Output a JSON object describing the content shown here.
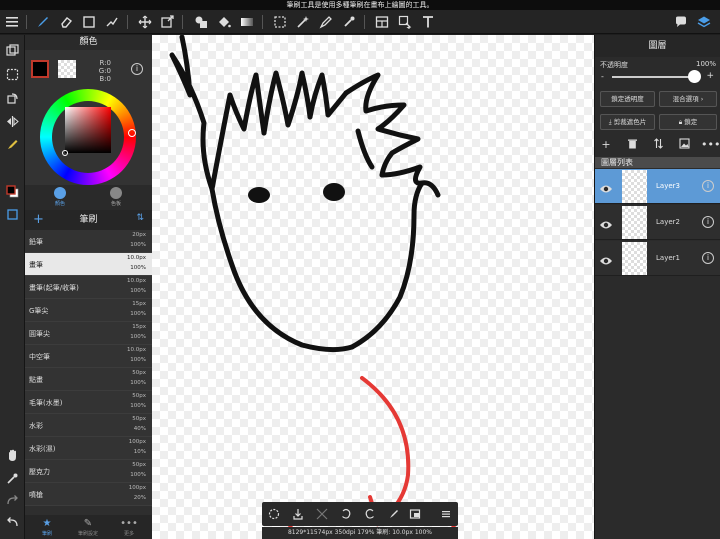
{
  "status_message": "筆刷工具是使用多種筆刷在畫布上繪圖的工具。",
  "color_panel": {
    "title": "顏色",
    "rgb": {
      "r": "R:0",
      "g": "G:0",
      "b": "B:0"
    },
    "info_label": "i",
    "tabs": [
      {
        "label": "顏色",
        "color": "#5aa0e6"
      },
      {
        "label": "色板",
        "color": "#888888"
      }
    ],
    "foreground_color": "#000000"
  },
  "brush_panel": {
    "title": "筆刷",
    "add_label": "+",
    "sort_label": "⇅",
    "items": [
      {
        "name": "鉛筆",
        "size": "20px",
        "opacity": "100%",
        "selected": false
      },
      {
        "name": "畫筆",
        "size": "10.0px",
        "opacity": "100%",
        "selected": true
      },
      {
        "name": "畫筆(起筆/收筆)",
        "size": "10.0px",
        "opacity": "100%",
        "selected": false
      },
      {
        "name": "G筆尖",
        "size": "15px",
        "opacity": "100%",
        "selected": false
      },
      {
        "name": "圓筆尖",
        "size": "15px",
        "opacity": "100%",
        "selected": false
      },
      {
        "name": "中空筆",
        "size": "10.0px",
        "opacity": "100%",
        "selected": false
      },
      {
        "name": "點畫",
        "size": "50px",
        "opacity": "100%",
        "selected": false
      },
      {
        "name": "毛筆(水墨)",
        "size": "50px",
        "opacity": "100%",
        "selected": false
      },
      {
        "name": "水彩",
        "size": "50px",
        "opacity": "40%",
        "selected": false
      },
      {
        "name": "水彩(濕)",
        "size": "100px",
        "opacity": "10%",
        "selected": false
      },
      {
        "name": "壓克力",
        "size": "50px",
        "opacity": "100%",
        "selected": false
      },
      {
        "name": "噴槍",
        "size": "100px",
        "opacity": "20%",
        "selected": false
      }
    ],
    "tabs": [
      {
        "label": "筆刷",
        "icon": "star-icon",
        "active": true
      },
      {
        "label": "筆刷設定",
        "icon": "brush-settings-icon",
        "active": false
      },
      {
        "label": "更多",
        "icon": "more-icon",
        "active": false
      }
    ]
  },
  "canvas": {
    "info_bar": "8129*11574px 350dpi 179% 筆刷: 10.0px 100%"
  },
  "layer_panel": {
    "title": "圖層",
    "opacity_label": "不透明度",
    "opacity_value": "100%",
    "opacity_fraction": 1.0,
    "minus_label": "-",
    "plus_label": "+",
    "lock_opacity_label": "鎖定透明度",
    "blend_mode_label": "混合選項",
    "clipping_label": "剪裁遮色片",
    "lock_label": "鎖定",
    "list_title": "圖層列表",
    "layers": [
      {
        "name": "Layer3",
        "selected": true
      },
      {
        "name": "Layer2",
        "selected": false
      },
      {
        "name": "Layer1",
        "selected": false
      }
    ]
  },
  "colors": {
    "accent": "#5aa0e6",
    "selected_layer": "#5d9ad6",
    "annotation_red": "#e53935"
  }
}
